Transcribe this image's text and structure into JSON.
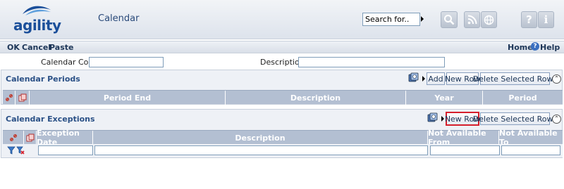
{
  "header": {
    "logo_text": "agility",
    "title": "Calendar",
    "search_value": "Search for.."
  },
  "toolbar": {
    "ok": "OK",
    "cancel": "Cancel",
    "paste": "Paste",
    "home": "Home",
    "help": "Help"
  },
  "form": {
    "calendar_code_label": "Calendar Code",
    "calendar_code_value": "",
    "description_label": "Description",
    "description_value": ""
  },
  "periods": {
    "title": "Calendar Periods",
    "add": "Add",
    "new_row": "New Row",
    "delete_rows": "Delete Selected Rows",
    "columns": [
      "Period End",
      "Description",
      "Year",
      "Period"
    ]
  },
  "exceptions": {
    "title": "Calendar Exceptions",
    "new_row": "New Row",
    "delete_rows": "Delete Selected Rows",
    "columns": [
      "Exception Date",
      "Description",
      "Not Available From",
      "Not Available To"
    ]
  },
  "colors": {
    "accent": "#2a5086",
    "grid_header": "#b3bfd2",
    "highlight": "#d61f2c"
  }
}
